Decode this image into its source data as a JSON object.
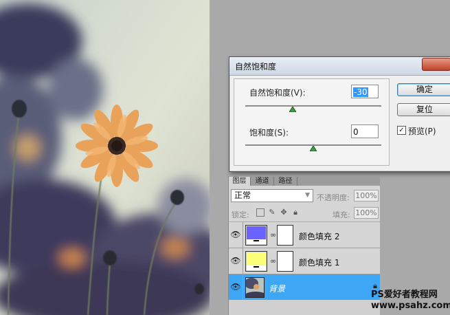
{
  "dialog": {
    "title": "自然饱和度",
    "vibrance_label": "自然饱和度(V):",
    "vibrance_value": "-30",
    "vibrance_level": -30,
    "saturation_label": "饱和度(S):",
    "saturation_value": "0",
    "saturation_level": 0,
    "ok_label": "确定",
    "reset_label": "复位",
    "preview_label": "预览(P)",
    "preview_checked": true
  },
  "layers_panel": {
    "tabs": [
      {
        "label": "图层",
        "active": true
      },
      {
        "label": "通道",
        "active": false
      },
      {
        "label": "路径",
        "active": false
      }
    ],
    "blend_mode": "正常",
    "opacity_label": "不透明度:",
    "opacity_value": "100%",
    "lock_label": "锁定:",
    "fill_label": "填充:",
    "fill_value": "100%",
    "layers": [
      {
        "name": "颜色填充 2",
        "color": "#6b63ff",
        "visible": true,
        "selected": false
      },
      {
        "name": "颜色填充 1",
        "color": "#fbff78",
        "visible": true,
        "selected": false
      },
      {
        "name": "背景",
        "visible": true,
        "selected": true,
        "locked": true
      }
    ]
  },
  "watermark": {
    "line1": "PS爱好者教程网",
    "line2": "www.psahz.com"
  },
  "icons": [
    "eye-icon",
    "chain-link-icon",
    "lock-icon",
    "move-icon",
    "brush-icon",
    "transparency-lock-icon",
    "close-icon"
  ]
}
